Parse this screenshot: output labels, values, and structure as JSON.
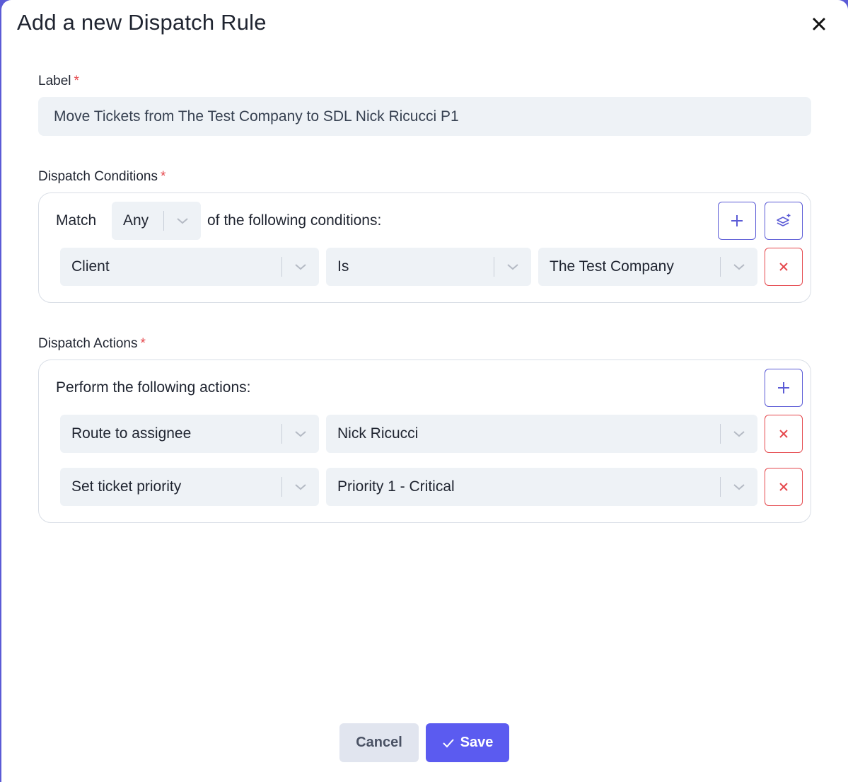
{
  "dialog": {
    "title": "Add a new Dispatch Rule"
  },
  "label_field": {
    "label": "Label",
    "required_mark": "*",
    "value": "Move Tickets from The Test Company to SDL Nick Ricucci P1"
  },
  "conditions": {
    "label": "Dispatch Conditions",
    "required_mark": "*",
    "match_prefix": "Match",
    "match_value": "Any",
    "match_suffix": "of the following conditions:",
    "rows": [
      {
        "field": "Client",
        "operator": "Is",
        "value": "The Test Company"
      }
    ]
  },
  "actions": {
    "label": "Dispatch Actions",
    "required_mark": "*",
    "intro": "Perform the following actions:",
    "rows": [
      {
        "action": "Route to assignee",
        "value": "Nick Ricucci"
      },
      {
        "action": "Set ticket priority",
        "value": "Priority 1 - Critical"
      }
    ]
  },
  "footer": {
    "cancel_label": "Cancel",
    "save_label": "Save"
  },
  "colors": {
    "accent": "#5b5bf0",
    "danger": "#e5484d",
    "field_bg": "#eef2f6"
  },
  "icons": {
    "close": "close-icon",
    "add": "plus-icon",
    "group": "layers-plus-icon",
    "remove": "x-icon",
    "dropdown": "chevron-down-icon",
    "save": "check-icon"
  }
}
